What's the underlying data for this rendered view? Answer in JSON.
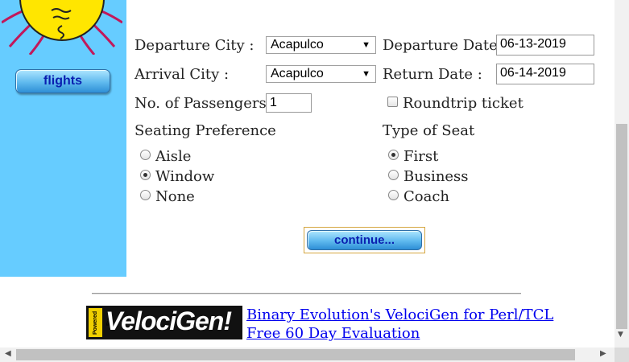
{
  "sidebar": {
    "flights_label": "flights"
  },
  "form": {
    "departure_city": {
      "label": "Departure City :",
      "value": "Acapulco"
    },
    "arrival_city": {
      "label": "Arrival City :",
      "value": "Acapulco"
    },
    "passengers": {
      "label": "No. of Passengers :",
      "value": "1"
    },
    "departure_date": {
      "label": "Departure Date :",
      "value": "06-13-2019"
    },
    "return_date": {
      "label": "Return Date :",
      "value": "06-14-2019"
    },
    "roundtrip": {
      "label": "Roundtrip ticket",
      "checked": false
    },
    "seating": {
      "title": "Seating Preference",
      "options": [
        "Aisle",
        "Window",
        "None"
      ],
      "selected": "Window"
    },
    "seat_type": {
      "title": "Type of Seat",
      "options": [
        "First",
        "Business",
        "Coach"
      ],
      "selected": "First"
    },
    "continue_label": "continue..."
  },
  "footer": {
    "logo_powered": "Powered By",
    "logo_text": "VelociGen!",
    "link1": "Binary Evolution's VelociGen for Perl/TCL",
    "link2": "Free 60 Day Evaluation"
  }
}
